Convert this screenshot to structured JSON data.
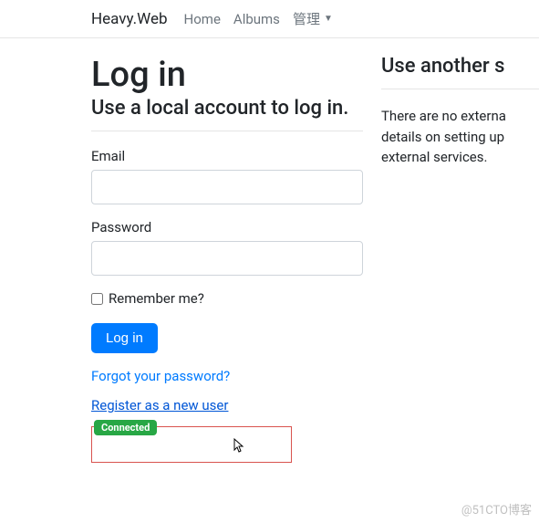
{
  "navbar": {
    "brand": "Heavy.Web",
    "links": [
      "Home",
      "Albums"
    ],
    "dropdown": "管理"
  },
  "login": {
    "heading": "Log in",
    "subheading": "Use a local account to log in.",
    "email_label": "Email",
    "password_label": "Password",
    "remember_label": "Remember me?",
    "submit_label": "Log in",
    "forgot_link": "Forgot your password?",
    "register_link": "Register as a new user",
    "badge": "Connected"
  },
  "external": {
    "heading": "Use another s",
    "text": "There are no externa details on setting up external services."
  },
  "watermark": "@51CTO博客"
}
